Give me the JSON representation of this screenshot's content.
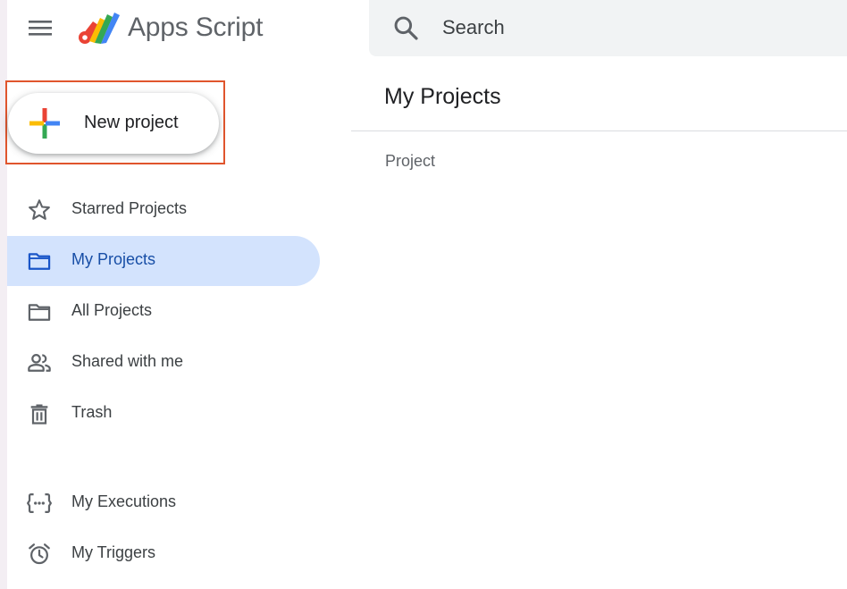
{
  "app": {
    "title": "Apps Script",
    "icons": {
      "menu": "hamburger-menu-icon",
      "logo": "apps-script-logo-icon"
    }
  },
  "search": {
    "placeholder": "Search",
    "icon": "search-icon"
  },
  "new_project": {
    "label": "New project",
    "icon": "plus-icon",
    "highlight_color": "#e0552d"
  },
  "sidebar": {
    "items": [
      {
        "label": "Starred Projects",
        "icon": "star-icon",
        "active": false
      },
      {
        "label": "My Projects",
        "icon": "folder-icon",
        "active": true
      },
      {
        "label": "All Projects",
        "icon": "folder-icon",
        "active": false
      },
      {
        "label": "Shared with me",
        "icon": "people-icon",
        "active": false
      },
      {
        "label": "Trash",
        "icon": "trash-icon",
        "active": false
      },
      {
        "label": "My Executions",
        "icon": "executions-icon",
        "active": false
      },
      {
        "label": "My Triggers",
        "icon": "alarm-clock-icon",
        "active": false
      }
    ],
    "active_color": "#d3e3fd",
    "active_text_color": "#174ea6"
  },
  "main": {
    "title": "My Projects",
    "columns": [
      "Project"
    ]
  }
}
